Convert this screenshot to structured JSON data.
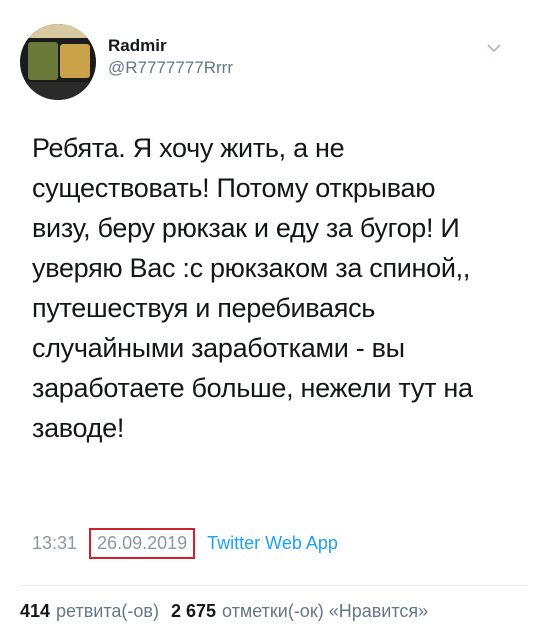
{
  "user": {
    "name": "Radmir",
    "handle": "@R7777777Rrrr"
  },
  "tweet": {
    "text": "Ребята. Я хочу жить, а не\nсуществовать! Потому открываю\nвизу, беру рюкзак и еду за бугор! И\nуверяю Вас :с рюкзаком за спиной,,\nпутешествуя и перебиваясь\nслучайными заработками - вы\nзаработаете больше, нежели тут на\nзаводе!"
  },
  "meta": {
    "time": "13:31",
    "date": "26.09.2019",
    "source": "Twitter Web App"
  },
  "stats": {
    "retweets_count": "414",
    "retweets_label": "ретвита(-ов)",
    "likes_count": "2 675",
    "likes_label": "отметки(-ок) «Нравится»"
  },
  "colors": {
    "link": "#1da1f2",
    "highlight_border": "#d11f2c"
  },
  "icons": {
    "menu": "chevron-down-icon"
  }
}
